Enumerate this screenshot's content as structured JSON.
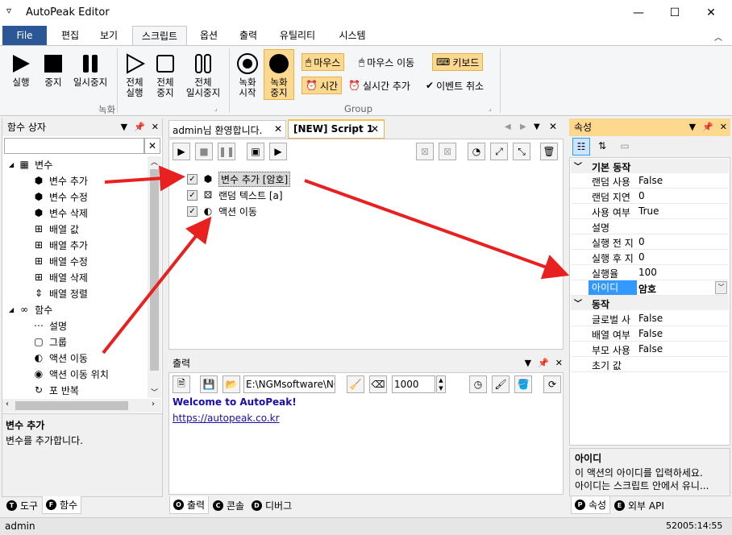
{
  "app": {
    "title": "AutoPeak Editor",
    "menu_glyph": "▿"
  },
  "window_controls": {
    "minimize": "—",
    "maximize": "☐",
    "close": "✕"
  },
  "ribbon_tabs": [
    "File",
    "편집",
    "보기",
    "스크립트",
    "옵션",
    "출력",
    "유틸리티",
    "시스템"
  ],
  "ribbon": {
    "run": {
      "label1": "실행"
    },
    "stop": {
      "label1": "중지"
    },
    "pause": {
      "label1": "일시중지"
    },
    "all_run": {
      "label1": "전체",
      "label2": "실행"
    },
    "all_stop": {
      "label1": "전체",
      "label2": "중지"
    },
    "all_pause": {
      "label1": "전체",
      "label2": "일시중지"
    },
    "record_group": "녹화",
    "rec_start": {
      "label1": "녹화",
      "label2": "시작"
    },
    "rec_stop": {
      "label1": "녹화",
      "label2": "중지"
    },
    "mouse": "마우스",
    "mouse_move": "마우스 이동",
    "keyboard": "키보드",
    "time": "시간",
    "realtime_add": "실시간 추가",
    "event_cancel": "이벤트 취소",
    "group_label": "Group"
  },
  "function_box": {
    "title": "함수 상자",
    "tree": [
      {
        "label": "변수",
        "icon": "variable-group-icon",
        "level": 0,
        "expander": "◢"
      },
      {
        "label": "변수 추가",
        "icon": "cube-add-icon",
        "level": 1
      },
      {
        "label": "변수 수정",
        "icon": "cube-edit-icon",
        "level": 1
      },
      {
        "label": "변수 삭제",
        "icon": "cube-delete-icon",
        "level": 1
      },
      {
        "label": "배열 값",
        "icon": "array-value-icon",
        "level": 1
      },
      {
        "label": "배열 추가",
        "icon": "array-add-icon",
        "level": 1
      },
      {
        "label": "배열 수정",
        "icon": "array-edit-icon",
        "level": 1
      },
      {
        "label": "배열 삭제",
        "icon": "array-delete-icon",
        "level": 1
      },
      {
        "label": "배열 정렬",
        "icon": "sort-icon",
        "level": 1
      },
      {
        "label": "함수",
        "icon": "function-group-icon",
        "level": 0,
        "expander": "◢"
      },
      {
        "label": "설명",
        "icon": "comment-icon",
        "level": 1
      },
      {
        "label": "그룹",
        "icon": "group-icon",
        "level": 1
      },
      {
        "label": "액션 이동",
        "icon": "action-move-icon",
        "level": 1
      },
      {
        "label": "액션 이동 위치",
        "icon": "action-target-icon",
        "level": 1
      },
      {
        "label": "포 반복",
        "icon": "loop-icon",
        "level": 1
      }
    ],
    "desc_title": "변수 추가",
    "desc_text": "변수를 추가합니다."
  },
  "left_tabs": [
    {
      "badge": "T",
      "label": "도구"
    },
    {
      "badge": "F",
      "label": "함수"
    }
  ],
  "doc_tabs": [
    "admin님 환영합니다.",
    "[NEW] Script 1"
  ],
  "script_items": [
    {
      "label": "변수 추가 [암호]",
      "checked": true,
      "icon": "cube-add-icon",
      "selected": true
    },
    {
      "label": "랜덤 텍스트 [a]",
      "checked": true,
      "icon": "dice-icon",
      "selected": false
    },
    {
      "label": "액션 이동",
      "checked": true,
      "icon": "action-move-icon",
      "selected": false
    }
  ],
  "output": {
    "title": "출력",
    "path": "E:\\NGMsoftware\\NG",
    "number": "1000",
    "lines": [
      "Welcome to AutoPeak!",
      "https://autopeak.co.kr"
    ]
  },
  "output_tabs": [
    {
      "badge": "O",
      "label": "출력"
    },
    {
      "badge": "C",
      "label": "콘솔"
    },
    {
      "badge": "D",
      "label": "디버그"
    }
  ],
  "properties": {
    "title": "속성",
    "cat1": "기본 동작",
    "rows1": [
      {
        "name": "랜덤 사용",
        "value": "False"
      },
      {
        "name": "랜덤 지연",
        "value": "0"
      },
      {
        "name": "사용 여부",
        "value": "True"
      },
      {
        "name": "설명",
        "value": ""
      },
      {
        "name": "실행 전 지",
        "value": "0"
      },
      {
        "name": "실행 후 지",
        "value": "0"
      },
      {
        "name": "실행율",
        "value": "100"
      },
      {
        "name": "아이디",
        "value": "암호",
        "selected": true
      }
    ],
    "cat2": "동작",
    "rows2": [
      {
        "name": "글로벌 사",
        "value": "False"
      },
      {
        "name": "배열 여부",
        "value": "False"
      },
      {
        "name": "부모 사용",
        "value": "False"
      },
      {
        "name": "초기 값",
        "value": ""
      }
    ],
    "desc_title": "아이디",
    "desc_line1": "이 액션의 아이디를 입력하세요.",
    "desc_line2": "아이디는 스크립트 안에서 유니..."
  },
  "right_tabs": [
    {
      "badge": "P",
      "label": "속성"
    },
    {
      "badge": "E",
      "label": "외부 API"
    }
  ],
  "status": {
    "user": "admin",
    "time": "52005:14:55"
  },
  "colors": {
    "accent": "#2b5797",
    "selection": "#3399ff",
    "arrow": "#e82020",
    "highlight": "#fcd98f",
    "link": "#1a0dab"
  }
}
